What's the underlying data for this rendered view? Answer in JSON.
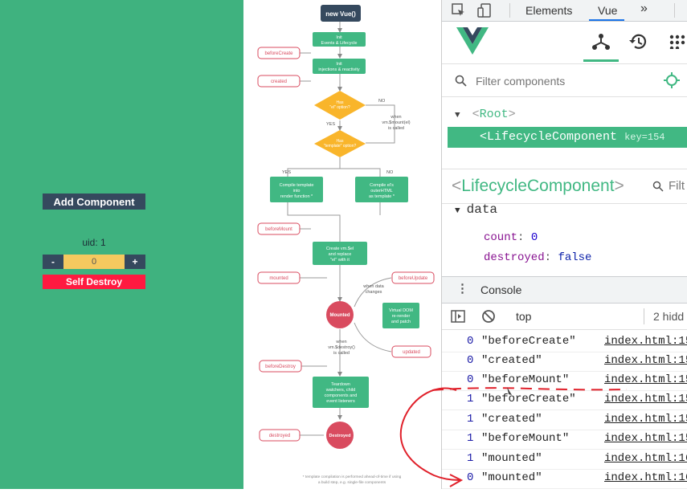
{
  "app": {
    "add_button": "Add Component",
    "uid_label": "uid: 1",
    "minus": "-",
    "plus": "+",
    "count_value": "0",
    "destroy_button": "Self Destroy"
  },
  "diagram": {
    "new_vue": "new Vue()",
    "init_events": [
      "Init",
      "Events & Lifecycle"
    ],
    "init_injections": [
      "Init",
      "injections & reactivity"
    ],
    "el_option": [
      "Has",
      "\"el\" option?"
    ],
    "template_option": [
      "Has",
      "\"template\" option?"
    ],
    "when_mount": [
      "when",
      "vm.$mount(el)",
      "is called"
    ],
    "yes": "YES",
    "no": "NO",
    "compile_template": [
      "Compile template",
      "into",
      "render function *"
    ],
    "compile_el": [
      "Compile el's",
      "outerHTML",
      "as template *"
    ],
    "create_el": [
      "Create vm.$el",
      "and replace",
      "\"el\" with it"
    ],
    "when_data": [
      "when data",
      "changes"
    ],
    "virtual_dom": [
      "Virtual DOM",
      "re-render",
      "and patch"
    ],
    "mounted_circle": "Mounted",
    "when_destroy": [
      "when",
      "vm.$destroy()",
      "is called"
    ],
    "teardown": [
      "Teardown",
      "watchers, child",
      "components and",
      "event listeners"
    ],
    "destroyed_circle": "Destroyed",
    "hooks": {
      "beforeCreate": "beforeCreate",
      "created": "created",
      "beforeMount": "beforeMount",
      "mounted": "mounted",
      "beforeUpdate": "beforeUpdate",
      "updated": "updated",
      "beforeDestroy": "beforeDestroy",
      "destroyed": "destroyed"
    },
    "footnote": [
      "* template compilation is performed ahead-of-time if using",
      "a build step, e.g. single-file components"
    ]
  },
  "devtools": {
    "tabs": {
      "elements": "Elements",
      "vue": "Vue",
      "more": "»"
    },
    "filter_placeholder": "Filter components",
    "tree": {
      "root": "Root",
      "selected": "LifecycleComponent",
      "selected_key": "key=154"
    },
    "inspector": {
      "title": "LifecycleComponent",
      "filter": "Filt",
      "section": "data",
      "props": [
        {
          "key": "count",
          "value": "0",
          "kind": "num"
        },
        {
          "key": "destroyed",
          "value": "false",
          "kind": "bool"
        }
      ]
    },
    "console": {
      "title": "Console",
      "context": "top",
      "hidden": "2 hidd",
      "logs": [
        {
          "count": "0",
          "msg": "\"beforeCreate\"",
          "src": "index.html:15"
        },
        {
          "count": "0",
          "msg": "\"created\"",
          "src": "index.html:15"
        },
        {
          "count": "0",
          "msg": "\"beforeMount\"",
          "src": "index.html:15"
        },
        {
          "count": "1",
          "msg": "\"beforeCreate\"",
          "src": "index.html:15"
        },
        {
          "count": "1",
          "msg": "\"created\"",
          "src": "index.html:15"
        },
        {
          "count": "1",
          "msg": "\"beforeMount\"",
          "src": "index.html:15"
        },
        {
          "count": "1",
          "msg": "\"mounted\"",
          "src": "index.html:16"
        },
        {
          "count": "0",
          "msg": "\"mounted\"",
          "src": "index.html:16"
        }
      ]
    }
  },
  "colors": {
    "vue_green": "#41b883",
    "vue_dark": "#35495e",
    "hook_red": "#d94b5f",
    "decision_orange": "#f9b52b",
    "annotation_red": "#e0202a"
  }
}
